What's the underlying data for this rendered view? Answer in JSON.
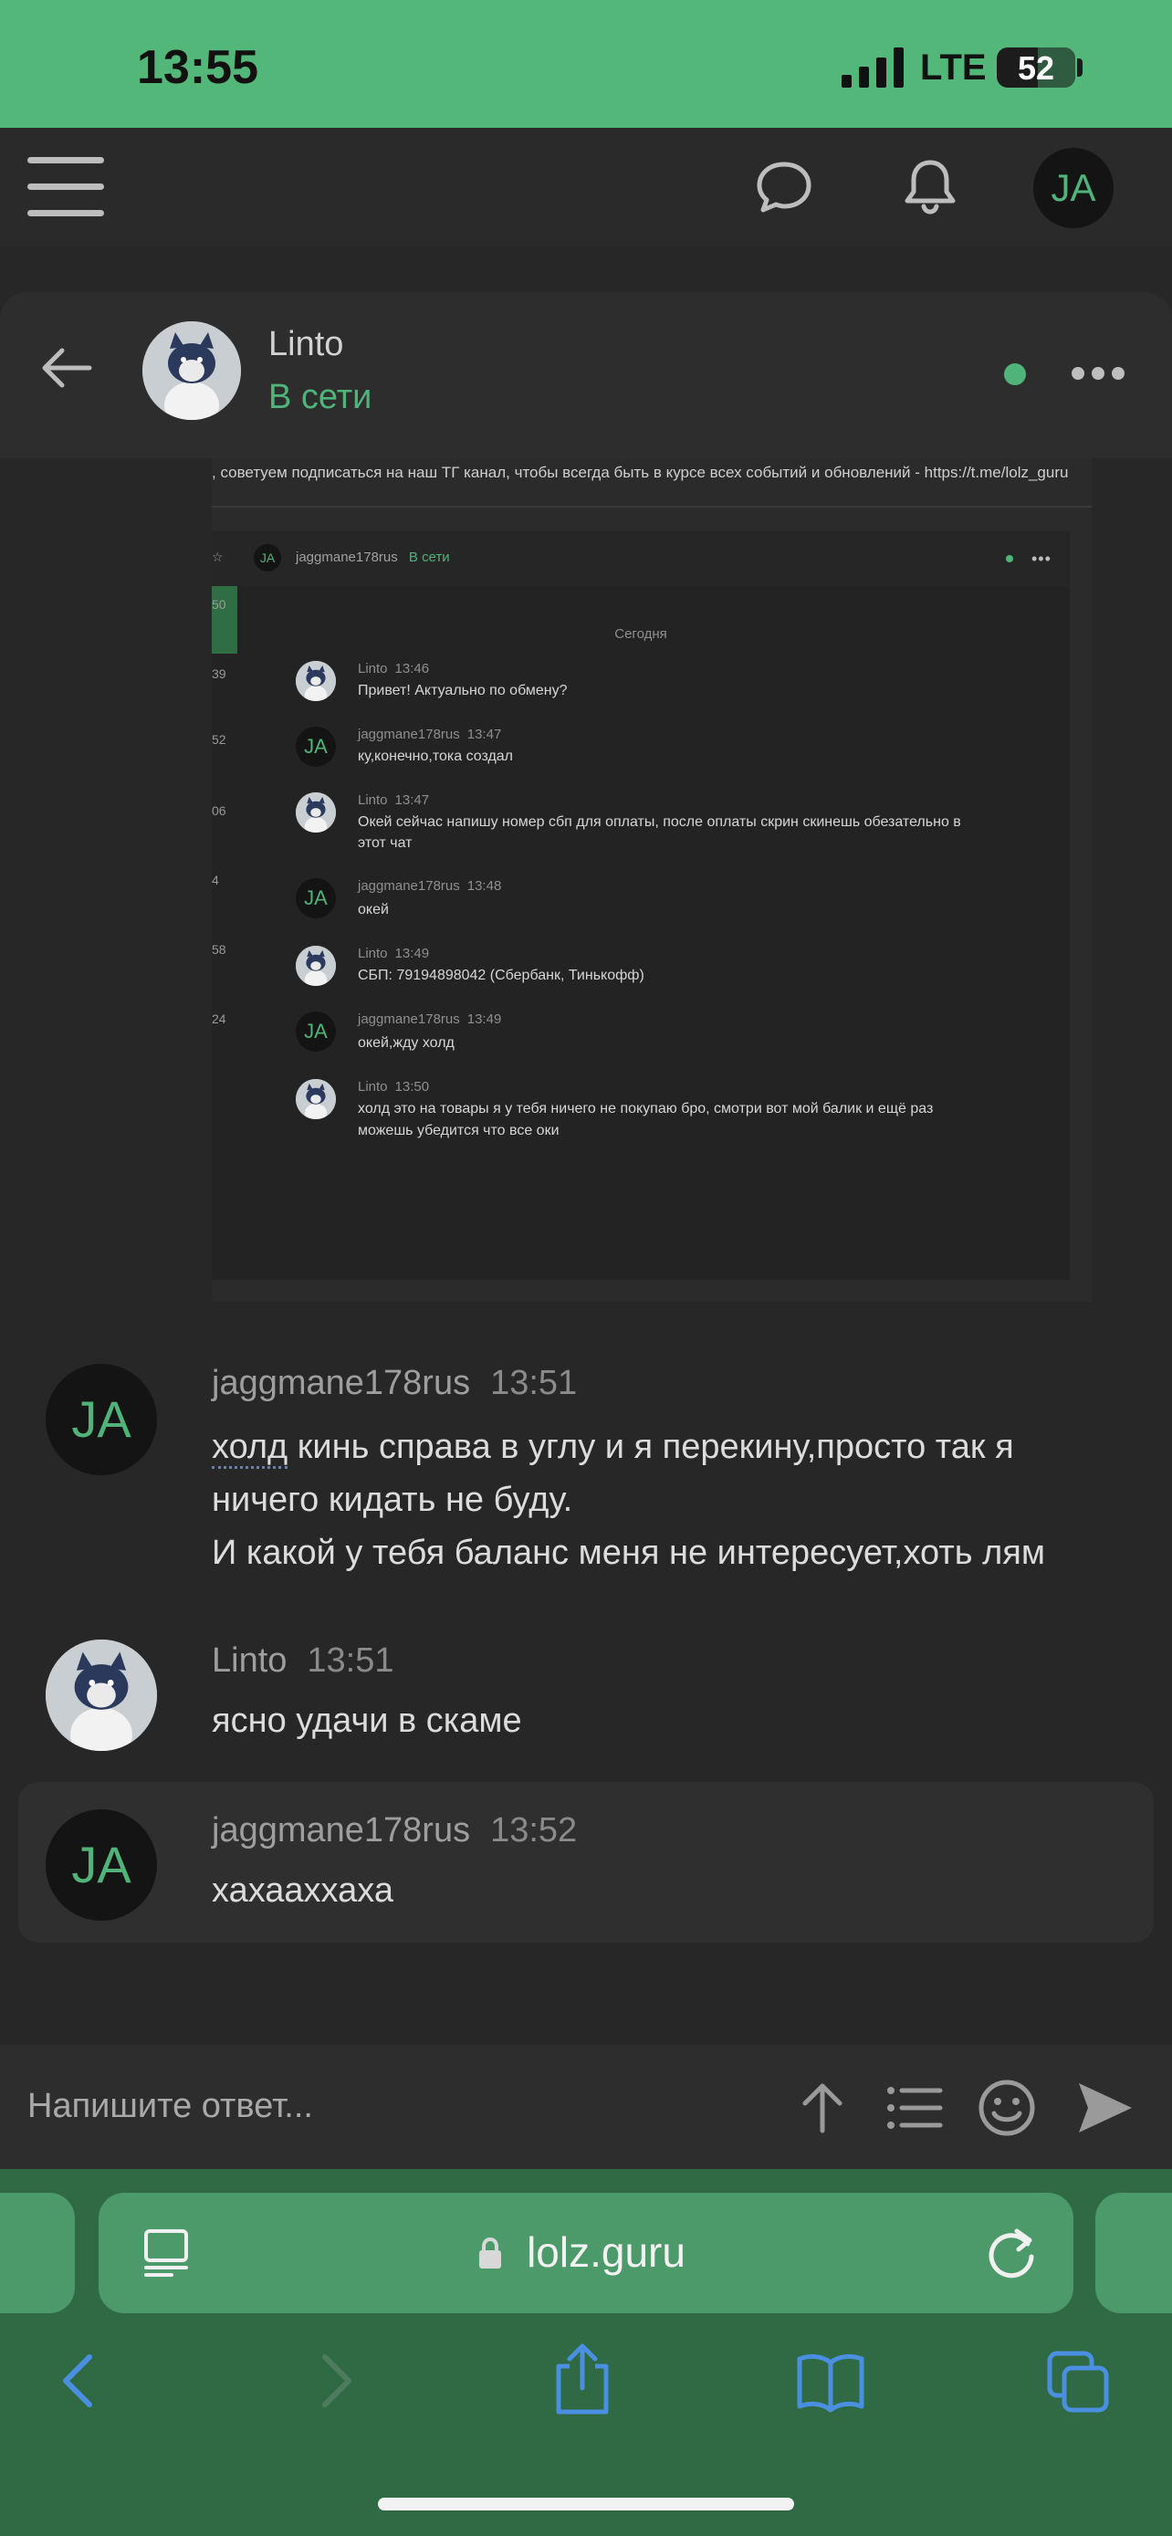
{
  "status_bar": {
    "time": "13:55",
    "network": "LTE",
    "battery": "52",
    "battery_level": 0.52
  },
  "top_nav": {
    "avatar_initials": "JA"
  },
  "chat_header": {
    "name": "Linto",
    "status": "В сети"
  },
  "embedded_screenshot": {
    "notice": ", советуем подписаться на наш ТГ канал, чтобы всегда быть в курсе всех событий и обновлений - https://t.me/lolz_guru",
    "header": {
      "avatar_initials": "JA",
      "name": "jaggmane178rus",
      "status": "В сети"
    },
    "date_label": "Сегодня",
    "edge_numbers": [
      "50",
      "39",
      "52",
      "06",
      "4",
      "58",
      "24"
    ],
    "messages": [
      {
        "author": "Linto",
        "time": "13:46",
        "lines": [
          "Привет! Актуально по обмену?"
        ]
      },
      {
        "author": "jaggmane178rus",
        "time": "13:47",
        "lines": [
          "ку,конечно,тока создал"
        ]
      },
      {
        "author": "Linto",
        "time": "13:47",
        "lines": [
          "Окей сейчас напишу номер сбп для оплаты, после оплаты скрин скинешь обезательно в",
          "этот чат"
        ]
      },
      {
        "author": "jaggmane178rus",
        "time": "13:48",
        "lines": [
          "окей"
        ]
      },
      {
        "author": "Linto",
        "time": "13:49",
        "lines": [
          "СБП: 79194898042 (Сбербанк, Тинькофф)"
        ]
      },
      {
        "author": "jaggmane178rus",
        "time": "13:49",
        "lines": [
          "окей,жду холд"
        ]
      },
      {
        "author": "Linto",
        "time": "13:50",
        "lines": [
          "холд это на товары я у тебя ничего не покупаю бро, смотри вот мой балик и ещё раз",
          "можешь убедится что все оки"
        ]
      }
    ]
  },
  "messages": [
    {
      "author": "jaggmane178rus",
      "avatar_initials": "JA",
      "time": "13:51",
      "lines": [
        "ничего кидать не буду.",
        "И какой у тебя баланс меня не интересует,хоть лям"
      ],
      "first_line_word": "холд",
      "first_line_rest": " кинь справа в углу и я перекину,просто так я"
    },
    {
      "author": "Linto",
      "time": "13:51",
      "lines": [
        "ясно удачи в скаме"
      ]
    },
    {
      "author": "jaggmane178rus",
      "avatar_initials": "JA",
      "time": "13:52",
      "lines": [
        "хахааххаха"
      ]
    }
  ],
  "reply": {
    "placeholder": "Напишите ответ..."
  },
  "safari": {
    "url": "lolz.guru"
  },
  "colors": {
    "accent": "#4fb37a",
    "status_bar": "#54b77a",
    "background": "#272727",
    "safari_bar": "#2f6a45"
  }
}
